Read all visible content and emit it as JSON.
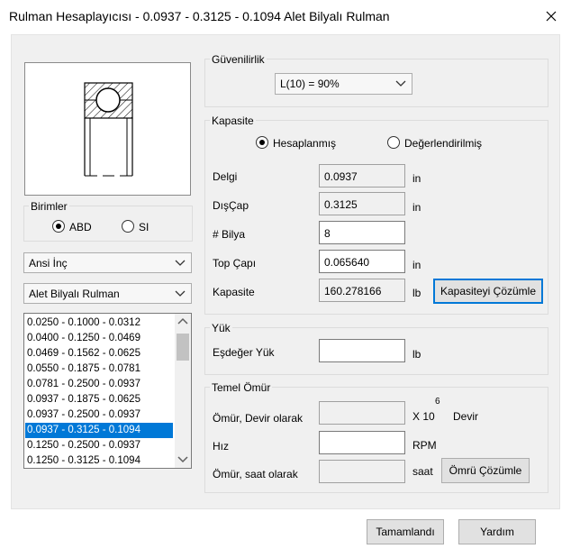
{
  "window": {
    "title": "Rulman Hesaplayıcısı - 0.0937 - 0.3125 - 0.1094 Alet Bilyalı Rulman"
  },
  "units": {
    "label": "Birimler",
    "options": [
      "ABD",
      "SI"
    ],
    "selected": "ABD"
  },
  "standard_combo": {
    "value": "Ansi İnç"
  },
  "type_combo": {
    "value": "Alet Bilyalı Rulman"
  },
  "size_list": {
    "items": [
      "0.0250 - 0.1000 - 0.0312",
      "0.0400 - 0.1250 - 0.0469",
      "0.0469 - 0.1562 - 0.0625",
      "0.0550 - 0.1875 - 0.0781",
      "0.0781 - 0.2500 - 0.0937",
      "0.0937 - 0.1875 - 0.0625",
      "0.0937 - 0.2500 - 0.0937",
      "0.0937 - 0.3125 - 0.1094",
      "0.1250 - 0.2500 - 0.0937",
      "0.1250 - 0.3125 - 0.1094"
    ],
    "selected_index": 7
  },
  "reliability": {
    "label": "Güvenilirlik",
    "value": "L(10) = 90%"
  },
  "capacity": {
    "label": "Kapasite",
    "mode_options": [
      "Hesaplanmış",
      "Değerlendirilmiş"
    ],
    "mode_selected": "Hesaplanmış",
    "bore": {
      "label": "Delgi",
      "value": "0.0937",
      "unit": "in"
    },
    "outer_dia": {
      "label": "DışÇap",
      "value": "0.3125",
      "unit": "in"
    },
    "ball_count": {
      "label": "# Bilya",
      "value": "8"
    },
    "ball_dia": {
      "label": "Top Çapı",
      "value": "0.065640",
      "unit": "in"
    },
    "capacity": {
      "label": "Kapasite",
      "value": "160.278166",
      "unit": "lb"
    },
    "solve_button": "Kapasiteyi Çözümle"
  },
  "load": {
    "label": "Yük",
    "equiv_load": {
      "label": "Eşdeğer Yük",
      "value": "",
      "unit": "lb"
    }
  },
  "life": {
    "label": "Temel Ömür",
    "life_rev": {
      "label": "Ömür, Devir olarak",
      "value": "",
      "unit": "X 10",
      "exponent": "6",
      "unit_suffix": "Devir"
    },
    "speed": {
      "label": "Hız",
      "value": "",
      "unit": "RPM"
    },
    "life_hours": {
      "label": "Ömür, saat olarak",
      "value": "",
      "unit": "saat"
    },
    "solve_button": "Ömrü Çözümle"
  },
  "footer": {
    "ok_button": "Tamamlandı",
    "help_button": "Yardım"
  }
}
